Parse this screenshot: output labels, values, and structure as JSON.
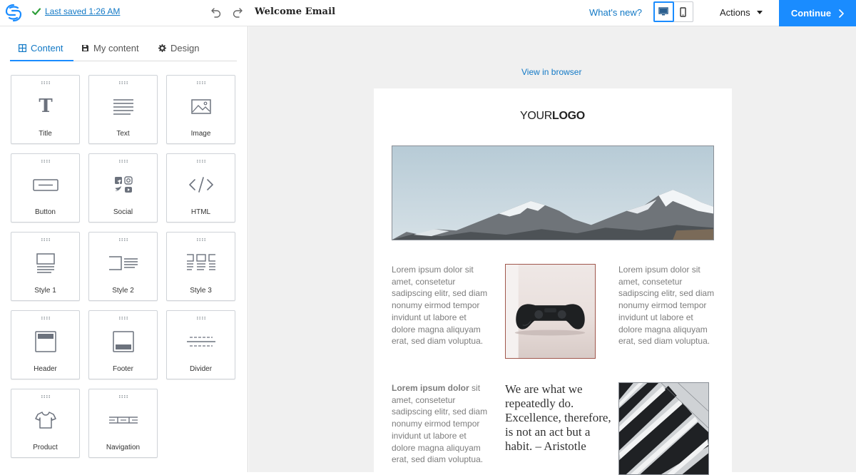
{
  "topbar": {
    "last_saved": "Last saved 1:26 AM",
    "document_title": "Welcome Email",
    "whats_new": "What's new?",
    "actions_label": "Actions",
    "continue_label": "Continue",
    "accent_color": "#1a8cff"
  },
  "panel": {
    "tabs": [
      {
        "label": "Content",
        "icon": "grid-icon",
        "active": true
      },
      {
        "label": "My content",
        "icon": "save-icon",
        "active": false
      },
      {
        "label": "Design",
        "icon": "gear-icon",
        "active": false
      }
    ],
    "blocks": [
      {
        "label": "Title",
        "icon": "title-icon"
      },
      {
        "label": "Text",
        "icon": "text-icon"
      },
      {
        "label": "Image",
        "icon": "image-icon"
      },
      {
        "label": "Button",
        "icon": "button-icon"
      },
      {
        "label": "Social",
        "icon": "social-icon"
      },
      {
        "label": "HTML",
        "icon": "code-icon"
      },
      {
        "label": "Style 1",
        "icon": "style1-icon"
      },
      {
        "label": "Style 2",
        "icon": "style2-icon"
      },
      {
        "label": "Style 3",
        "icon": "style3-icon"
      },
      {
        "label": "Header",
        "icon": "header-icon"
      },
      {
        "label": "Footer",
        "icon": "footer-icon"
      },
      {
        "label": "Divider",
        "icon": "divider-icon"
      },
      {
        "label": "Product",
        "icon": "tshirt-icon"
      },
      {
        "label": "Navigation",
        "icon": "navigation-icon"
      }
    ]
  },
  "canvas": {
    "view_in_browser": "View in browser",
    "logo_regular": "YOUR",
    "logo_bold": "LOGO",
    "lorem_left": "Lorem ipsum dolor sit amet, consetetur sadipscing elitr, sed diam nonumy eirmod tempor invidunt ut labore et dolore magna aliquyam erat, sed diam voluptua.",
    "lorem_right": "Lorem ipsum dolor sit amet, consetetur sadipscing elitr, sed diam nonumy eirmod tempor invidunt ut labore et dolore magna aliquyam erat, sed diam voluptua.",
    "lorem_bottom_bold": "Lorem ipsum dolor",
    "lorem_bottom_rest": "sit amet, consetetur sadipscing elitr, sed diam nonumy eirmod tempor invidunt ut labore et dolore magna aliquyam erat, sed diam voluptua.",
    "quote": "We are what we repeatedly do. Excellence, therefore, is not an act but a habit. – Aristotle"
  }
}
